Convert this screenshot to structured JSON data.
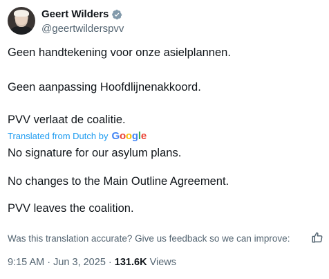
{
  "author": {
    "display_name": "Geert Wilders",
    "handle": "@geertwilderspvv"
  },
  "tweet": {
    "original_lines": [
      "Geen handtekening voor onze asielplannen.",
      "Geen aanpassing Hoofdlijnenakkoord.",
      "PVV verlaat de coalitie."
    ],
    "translated_label": "Translated from Dutch by",
    "translator_brand": "Google",
    "translated_lines": [
      "No signature for our asylum plans.",
      "No changes to the Main Outline Agreement.",
      "PVV leaves the coalition."
    ]
  },
  "feedback": {
    "prompt": "Was this translation accurate? Give us feedback so we can improve:"
  },
  "meta": {
    "time": "9:15 AM",
    "sep1": " · ",
    "date": "Jun 3, 2025",
    "sep2": " · ",
    "views_count": "131.6K",
    "views_label": " Views"
  },
  "colors": {
    "text": "#0f1419",
    "secondary": "#536471",
    "accent": "#1d9bf0"
  },
  "icons": {
    "verified": "verified-badge-icon",
    "feedback": "thumbs-up-icon"
  }
}
